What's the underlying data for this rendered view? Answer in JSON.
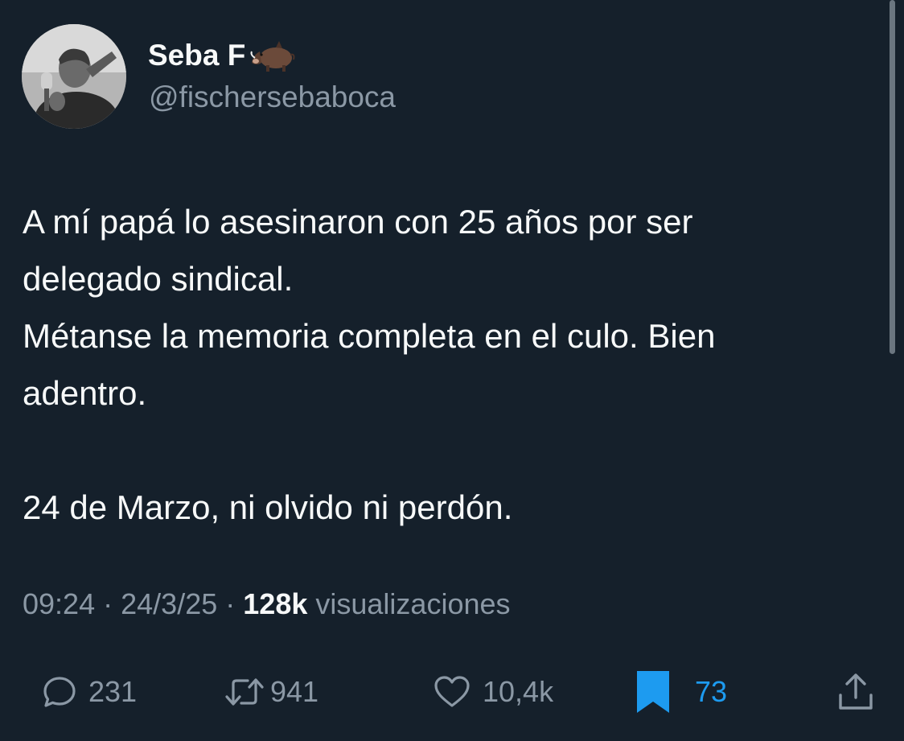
{
  "author": {
    "name": "Seba F",
    "handle": "@fischersebaboca",
    "name_emoji": "boar-emoji",
    "avatar": "grayscale photo of man speaking into microphone, pointing"
  },
  "tweet": {
    "lines": [
      "A mí papá lo asesinaron con 25 años por ser",
      "delegado sindical.",
      "Métanse la memoria completa en el culo. Bien",
      "adentro.",
      "",
      "24 de Marzo, ni olvido ni perdón."
    ]
  },
  "meta": {
    "time": "09:24",
    "date": "24/3/25",
    "separator": "·",
    "views_count": "128k",
    "views_label": "visualizaciones"
  },
  "actions": {
    "replies": {
      "icon": "reply-icon",
      "count": "231"
    },
    "retweets": {
      "icon": "retweet-icon",
      "count": "941"
    },
    "likes": {
      "icon": "heart-icon",
      "count": "10,4k"
    },
    "bookmarks": {
      "icon": "bookmark-icon",
      "count": "73",
      "active": true
    },
    "share": {
      "icon": "share-icon"
    }
  },
  "colors": {
    "background": "#15202b",
    "text": "#f7f9f9",
    "secondary": "#8b98a5",
    "accent": "#1d9bf0"
  }
}
